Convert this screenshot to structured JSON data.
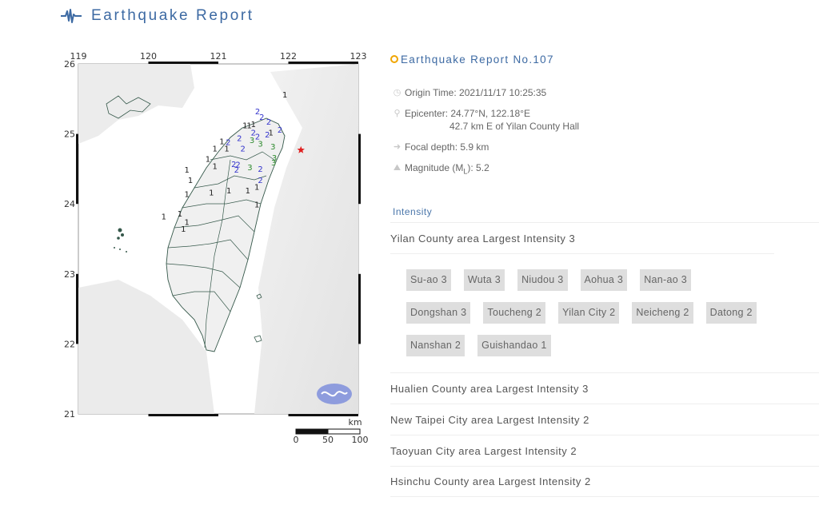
{
  "header": {
    "title": "Earthquake Report",
    "icon": "seismograph-icon"
  },
  "map": {
    "lon_ticks": [
      "119",
      "120",
      "121",
      "122",
      "123"
    ],
    "lat_ticks": [
      "26",
      "25",
      "24",
      "23",
      "22",
      "21"
    ],
    "scale_bar": {
      "unit": "km",
      "labels": [
        "0",
        "50",
        "100"
      ]
    },
    "epicenter_marker": "red-star",
    "logo": "cwb-logo",
    "station_intensities": [
      {
        "lon": 121.95,
        "lat": 25.52,
        "value": 1
      },
      {
        "lon": 121.56,
        "lat": 25.28,
        "value": 2
      },
      {
        "lon": 121.62,
        "lat": 25.2,
        "value": 2
      },
      {
        "lon": 121.72,
        "lat": 25.13,
        "value": 2
      },
      {
        "lon": 121.88,
        "lat": 25.02,
        "value": 2
      },
      {
        "lon": 121.7,
        "lat": 24.95,
        "value": 2
      },
      {
        "lon": 121.5,
        "lat": 24.98,
        "value": 2
      },
      {
        "lon": 121.56,
        "lat": 24.92,
        "value": 2
      },
      {
        "lon": 121.3,
        "lat": 24.9,
        "value": 2
      },
      {
        "lon": 121.14,
        "lat": 24.84,
        "value": 2
      },
      {
        "lon": 121.35,
        "lat": 24.75,
        "value": 2
      },
      {
        "lon": 121.48,
        "lat": 24.87,
        "value": 3
      },
      {
        "lon": 121.6,
        "lat": 24.82,
        "value": 3
      },
      {
        "lon": 121.78,
        "lat": 24.78,
        "value": 3
      },
      {
        "lon": 121.8,
        "lat": 24.62,
        "value": 3
      },
      {
        "lon": 121.79,
        "lat": 24.55,
        "value": 3
      },
      {
        "lon": 121.45,
        "lat": 24.48,
        "value": 3
      },
      {
        "lon": 121.22,
        "lat": 24.53,
        "value": 2
      },
      {
        "lon": 121.28,
        "lat": 24.52,
        "value": 2
      },
      {
        "lon": 121.26,
        "lat": 24.45,
        "value": 2
      },
      {
        "lon": 121.6,
        "lat": 24.46,
        "value": 2
      },
      {
        "lon": 121.6,
        "lat": 24.3,
        "value": 2
      },
      {
        "lon": 121.38,
        "lat": 25.08,
        "value": 1
      },
      {
        "lon": 121.44,
        "lat": 25.08,
        "value": 1
      },
      {
        "lon": 121.5,
        "lat": 25.1,
        "value": 1
      },
      {
        "lon": 121.75,
        "lat": 24.98,
        "value": 1
      },
      {
        "lon": 121.05,
        "lat": 24.85,
        "value": 1
      },
      {
        "lon": 121.12,
        "lat": 24.75,
        "value": 1
      },
      {
        "lon": 120.95,
        "lat": 24.75,
        "value": 1
      },
      {
        "lon": 120.85,
        "lat": 24.6,
        "value": 1
      },
      {
        "lon": 120.95,
        "lat": 24.5,
        "value": 1
      },
      {
        "lon": 120.55,
        "lat": 24.45,
        "value": 1
      },
      {
        "lon": 120.6,
        "lat": 24.3,
        "value": 1
      },
      {
        "lon": 120.9,
        "lat": 24.12,
        "value": 1
      },
      {
        "lon": 121.15,
        "lat": 24.15,
        "value": 1
      },
      {
        "lon": 121.42,
        "lat": 24.15,
        "value": 1
      },
      {
        "lon": 121.55,
        "lat": 24.2,
        "value": 1
      },
      {
        "lon": 120.55,
        "lat": 24.1,
        "value": 1
      },
      {
        "lon": 120.22,
        "lat": 23.78,
        "value": 1
      },
      {
        "lon": 120.45,
        "lat": 23.82,
        "value": 1
      },
      {
        "lon": 120.55,
        "lat": 23.7,
        "value": 1
      },
      {
        "lon": 120.5,
        "lat": 23.6,
        "value": 1
      },
      {
        "lon": 121.55,
        "lat": 23.95,
        "value": 1
      }
    ],
    "epicenter": {
      "lon": 122.18,
      "lat": 24.77
    }
  },
  "report": {
    "title": "Earthquake Report No.107",
    "origin_time": "Origin Time: 2021/11/17 10:25:35",
    "epicenter_line1": "Epicenter: 24.77°N, 122.18°E",
    "epicenter_line2": "42.7 km E of Yilan County Hall",
    "focal_depth": "Focal depth: 5.9 km",
    "magnitude_prefix": "Magnitude (M",
    "magnitude_sub": "L",
    "magnitude_suffix": "): 5.2"
  },
  "intensity": {
    "label": "Intensity",
    "areas": [
      {
        "title": "Yilan County area Largest Intensity 3",
        "stations": [
          "Su-ao 3",
          "Wuta 3",
          "Niudou 3",
          "Aohua 3",
          "Nan-ao 3",
          "Dongshan 3",
          "Toucheng 2",
          "Yilan City 2",
          "Neicheng 2",
          "Datong 2",
          "Nanshan 2",
          "Guishandao 1"
        ]
      },
      {
        "title": "Hualien County area Largest Intensity 3"
      },
      {
        "title": "New Taipei City area Largest Intensity 2"
      },
      {
        "title": "Taoyuan City area Largest Intensity 2"
      },
      {
        "title": "Hsinchu County area Largest Intensity 2"
      }
    ]
  },
  "colors": {
    "accent": "#3d6aa3",
    "intensity_1": "#222222",
    "intensity_2": "#3333cc",
    "intensity_3": "#2e8b2e",
    "epicenter": "#e02020",
    "report_dot": "#f0a500"
  }
}
